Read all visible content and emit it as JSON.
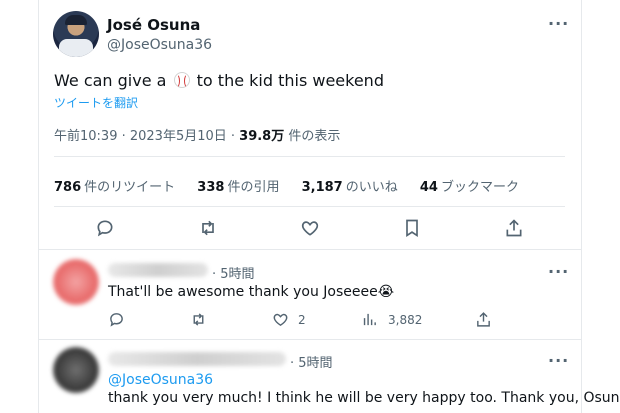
{
  "tweet": {
    "author_name": "José Osuna",
    "author_handle": "@JoseOsuna36",
    "text_before": "We can give a",
    "text_after": "to the kid this weekend",
    "translate_link": "ツイートを翻訳",
    "time": "午前10:39 · 2023年5月10日 · ",
    "views_number": "39.8万",
    "views_label": " 件の表示",
    "stats": {
      "retweets_number": "786",
      "retweets_label": "件のリツイート",
      "quotes_number": "338",
      "quotes_label": "件の引用",
      "likes_number": "3,187",
      "likes_label": "のいいね",
      "bookmarks_number": "44",
      "bookmarks_label": "ブックマーク"
    }
  },
  "replies": [
    {
      "time": "· 5時間",
      "text": "That'll be awesome thank you Joseeee😭",
      "likes": "2",
      "views": "3,882"
    },
    {
      "time": "· 5時間",
      "mention": "@JoseOsuna36",
      "text": "thank you very much! I think he will be very happy too. Thank you, Osuna."
    }
  ],
  "icons": [
    "more-icon",
    "reply-icon",
    "retweet-icon",
    "like-icon",
    "bookmark-icon",
    "share-icon",
    "views-icon",
    "baseball-icon"
  ]
}
